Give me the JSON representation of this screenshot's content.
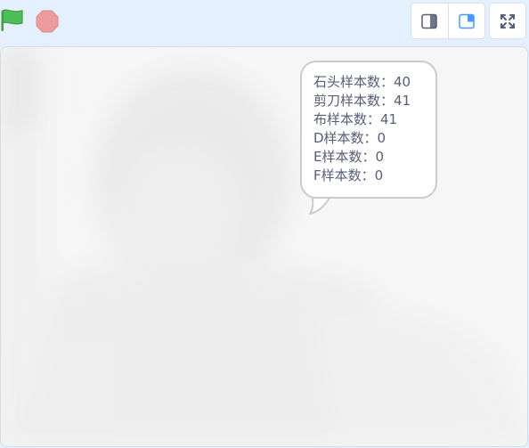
{
  "toolbar": {
    "green_flag_color": "#4cbf56",
    "stop_color": "#ec9c9c",
    "accent": "#4c97ff",
    "icons": {
      "green_flag": "green-flag-icon",
      "stop": "stop-icon",
      "small_stage": "small-stage-icon",
      "large_stage": "large-stage-icon",
      "fullscreen": "fullscreen-icon"
    }
  },
  "stage": {
    "background": "#f6f6f6",
    "speech_bubble": {
      "lines": [
        "石头样本数：40",
        "剪刀样本数：41",
        "布样本数：41",
        "D样本数：0",
        "E样本数：0",
        "F样本数：0"
      ]
    }
  }
}
